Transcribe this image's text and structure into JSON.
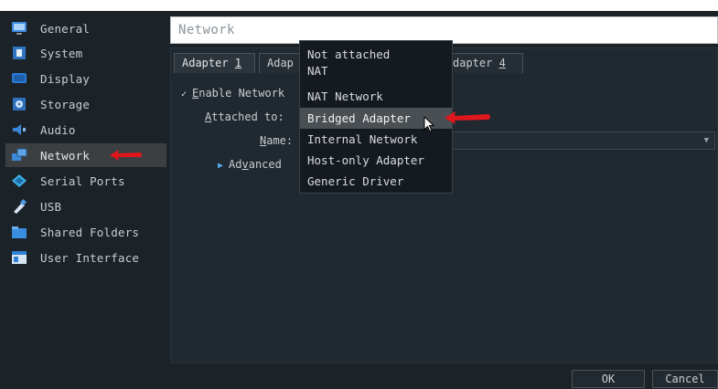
{
  "sidebar": {
    "items": [
      {
        "label": "General",
        "icon": "monitor-icon"
      },
      {
        "label": "System",
        "icon": "chip-icon"
      },
      {
        "label": "Display",
        "icon": "display-icon"
      },
      {
        "label": "Storage",
        "icon": "disk-icon"
      },
      {
        "label": "Audio",
        "icon": "speaker-icon"
      },
      {
        "label": "Network",
        "icon": "network-icon"
      },
      {
        "label": "Serial Ports",
        "icon": "serial-icon"
      },
      {
        "label": "USB",
        "icon": "usb-icon"
      },
      {
        "label": "Shared Folders",
        "icon": "folder-icon"
      },
      {
        "label": "User Interface",
        "icon": "window-icon"
      }
    ],
    "active": "Network"
  },
  "header": {
    "title": "Network"
  },
  "tabs": {
    "adapter1_prefix": "Adapter ",
    "adapter1_num": "1",
    "adapter2_partial": "Adap",
    "adapter4_partial_prefix": "dapter ",
    "adapter4_num": "4"
  },
  "form": {
    "enable_checked_glyph": "✓",
    "enable_first": "E",
    "enable_rest": "nable Network",
    "attached_first": "A",
    "attached_rest": "ttached to:",
    "name_first": "N",
    "name_rest": "ame:",
    "advanced_first": "Ad",
    "advanced_u": "v",
    "advanced_rest": "anced"
  },
  "dropdown": {
    "options": [
      "Not attached",
      "NAT",
      "NAT Network",
      "Bridged Adapter",
      "Internal Network",
      "Host-only Adapter",
      "Generic Driver"
    ],
    "selected": "Bridged Adapter"
  },
  "buttons": {
    "ok": "OK",
    "cancel": "Cancel"
  },
  "colors": {
    "accent": "#5aa8e6",
    "annotation_red": "#e0161c",
    "selected_bg": "#4a4f53"
  }
}
